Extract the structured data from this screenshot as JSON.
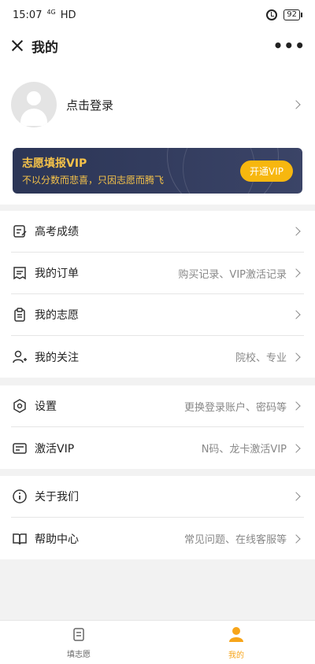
{
  "status": {
    "time": "15:07",
    "network": "4G",
    "signal": "HD",
    "battery": "92"
  },
  "nav": {
    "title": "我的",
    "more": "•••"
  },
  "profile": {
    "login_label": "点击登录"
  },
  "vip": {
    "title": "志愿填报VIP",
    "subtitle": "不以分数而悲喜，只因志愿而腾飞",
    "button": "开通VIP",
    "color": "#f5c249",
    "button_color": "#f7b70f",
    "card_color": "#2b3556"
  },
  "menu_group_1": [
    {
      "label": "高考成绩",
      "hint": "",
      "icon": "edit-score-icon"
    },
    {
      "label": "我的订单",
      "hint": "购买记录、VIP激活记录",
      "icon": "receipt-icon"
    },
    {
      "label": "我的志愿",
      "hint": "",
      "icon": "clipboard-icon"
    },
    {
      "label": "我的关注",
      "hint": "院校、专业",
      "icon": "user-follow-icon"
    }
  ],
  "menu_group_2": [
    {
      "label": "设置",
      "hint": "更换登录账户、密码等",
      "icon": "settings-icon"
    },
    {
      "label": "激活VIP",
      "hint": "N码、龙卡激活VIP",
      "icon": "card-icon"
    }
  ],
  "menu_group_3": [
    {
      "label": "关于我们",
      "hint": "",
      "icon": "info-icon"
    },
    {
      "label": "帮助中心",
      "hint": "常见问题、在线客服等",
      "icon": "book-icon"
    }
  ],
  "tabs": [
    {
      "label": "填志愿",
      "icon": "form-icon",
      "active": false
    },
    {
      "label": "我的",
      "icon": "profile-icon",
      "active": true
    }
  ],
  "accent_color": "#f7a51a"
}
